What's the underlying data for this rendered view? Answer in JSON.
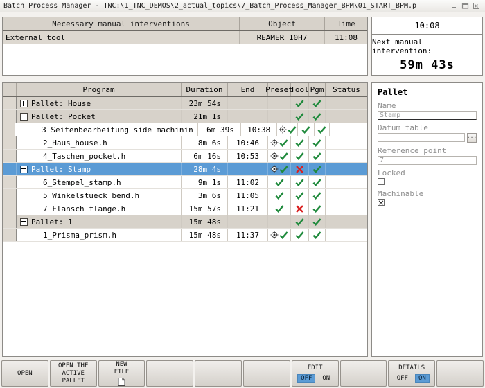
{
  "window": {
    "title": "Batch Process Manager - TNC:\\1_TNC_DEMOS\\2_actual_topics\\7_Batch_Process_Manager_BPM\\01_START_BPM.p",
    "minimize_icon": "minimize-icon",
    "restore_icon": "restore-icon",
    "close_icon": "close-icon"
  },
  "interventions": {
    "headers": {
      "name": "Necessary manual interventions",
      "object": "Object",
      "time": "Time"
    },
    "rows": [
      {
        "name": "External tool",
        "object": "REAMER_10H7",
        "time": "11:08"
      }
    ]
  },
  "clock": {
    "time": "10:08",
    "next_label": "Next manual intervention:",
    "countdown": "59m 43s"
  },
  "table": {
    "headers": {
      "gutter": "",
      "program": "Program",
      "duration": "Duration",
      "end": "End",
      "preset": "Preset",
      "tool": "Tool",
      "pgm": "Pgm",
      "status": "Status"
    },
    "rows": [
      {
        "type": "pallet",
        "expander": "plus",
        "selected": false,
        "program": "Pallet: House",
        "duration": "23m 54s",
        "end": "",
        "preset": "",
        "tool": "check",
        "pgm": "check",
        "status": ""
      },
      {
        "type": "pallet",
        "expander": "minus",
        "selected": false,
        "program": "Pallet: Pocket",
        "duration": "21m 1s",
        "end": "",
        "preset": "",
        "tool": "check",
        "pgm": "check",
        "status": ""
      },
      {
        "type": "prog",
        "expander": "none",
        "selected": false,
        "program": "3_Seitenbearbeitung_side_machinin_",
        "duration": "6m 39s",
        "end": "10:38",
        "preset": "target-check",
        "tool": "check",
        "pgm": "check",
        "status": ""
      },
      {
        "type": "prog",
        "expander": "none",
        "selected": false,
        "program": "2_Haus_house.h",
        "duration": "8m 6s",
        "end": "10:46",
        "preset": "target-check",
        "tool": "check",
        "pgm": "check",
        "status": ""
      },
      {
        "type": "prog",
        "expander": "none",
        "selected": false,
        "program": "4_Taschen_pocket.h",
        "duration": "6m 16s",
        "end": "10:53",
        "preset": "target-check",
        "tool": "check",
        "pgm": "check",
        "status": ""
      },
      {
        "type": "pallet",
        "expander": "minus",
        "selected": true,
        "program": "Pallet: Stamp",
        "duration": "28m 4s",
        "end": "",
        "preset": "target-check",
        "tool": "cross",
        "pgm": "check",
        "status": ""
      },
      {
        "type": "prog",
        "expander": "none",
        "selected": false,
        "program": "6_Stempel_stamp.h",
        "duration": "9m 1s",
        "end": "11:02",
        "preset": "check",
        "tool": "check",
        "pgm": "check",
        "status": ""
      },
      {
        "type": "prog",
        "expander": "none",
        "selected": false,
        "program": "5_Winkelstueck_bend.h",
        "duration": "3m 6s",
        "end": "11:05",
        "preset": "check",
        "tool": "check",
        "pgm": "check",
        "status": ""
      },
      {
        "type": "prog",
        "expander": "none",
        "selected": false,
        "program": "7_Flansch_flange.h",
        "duration": "15m 57s",
        "end": "11:21",
        "preset": "check",
        "tool": "cross",
        "pgm": "check",
        "status": ""
      },
      {
        "type": "pallet",
        "expander": "minus",
        "selected": false,
        "program": "Pallet: 1",
        "duration": "15m 48s",
        "end": "",
        "preset": "",
        "tool": "check",
        "pgm": "check",
        "status": ""
      },
      {
        "type": "prog",
        "expander": "none",
        "selected": false,
        "program": "1_Prisma_prism.h",
        "duration": "15m 48s",
        "end": "11:37",
        "preset": "target-check",
        "tool": "check",
        "pgm": "check",
        "status": ""
      }
    ]
  },
  "details": {
    "title": "Pallet",
    "name_label": "Name",
    "name_value": "Stamp",
    "datum_label": "Datum table",
    "datum_value": "",
    "datum_browse_icon": "browse-icon",
    "ref_label": "Reference point",
    "ref_value": "7",
    "locked_label": "Locked",
    "locked_checked": false,
    "machinable_label": "Machinable",
    "machinable_checked": true
  },
  "softkeys": [
    {
      "lines": [
        "OPEN"
      ],
      "icon": "",
      "toggle": null
    },
    {
      "lines": [
        "OPEN THE",
        "ACTIVE",
        "PALLET"
      ],
      "icon": "",
      "toggle": null
    },
    {
      "lines": [
        "NEW",
        "FILE"
      ],
      "icon": "file-icon",
      "toggle": null
    },
    {
      "lines": [],
      "icon": "",
      "toggle": null
    },
    {
      "lines": [],
      "icon": "",
      "toggle": null
    },
    {
      "lines": [],
      "icon": "",
      "toggle": null
    },
    {
      "lines": [
        "EDIT"
      ],
      "icon": "",
      "toggle": {
        "off": "OFF",
        "on": "ON",
        "active": "off"
      }
    },
    {
      "lines": [],
      "icon": "",
      "toggle": null
    },
    {
      "lines": [
        "DETAILS"
      ],
      "icon": "",
      "toggle": {
        "off": "OFF",
        "on": "ON",
        "active": "on"
      }
    },
    {
      "lines": [],
      "icon": "",
      "toggle": null
    }
  ],
  "colors": {
    "selection": "#5b9bd5",
    "header": "#d7d2ca",
    "ok": "#1f8a3c",
    "error": "#d92020"
  }
}
